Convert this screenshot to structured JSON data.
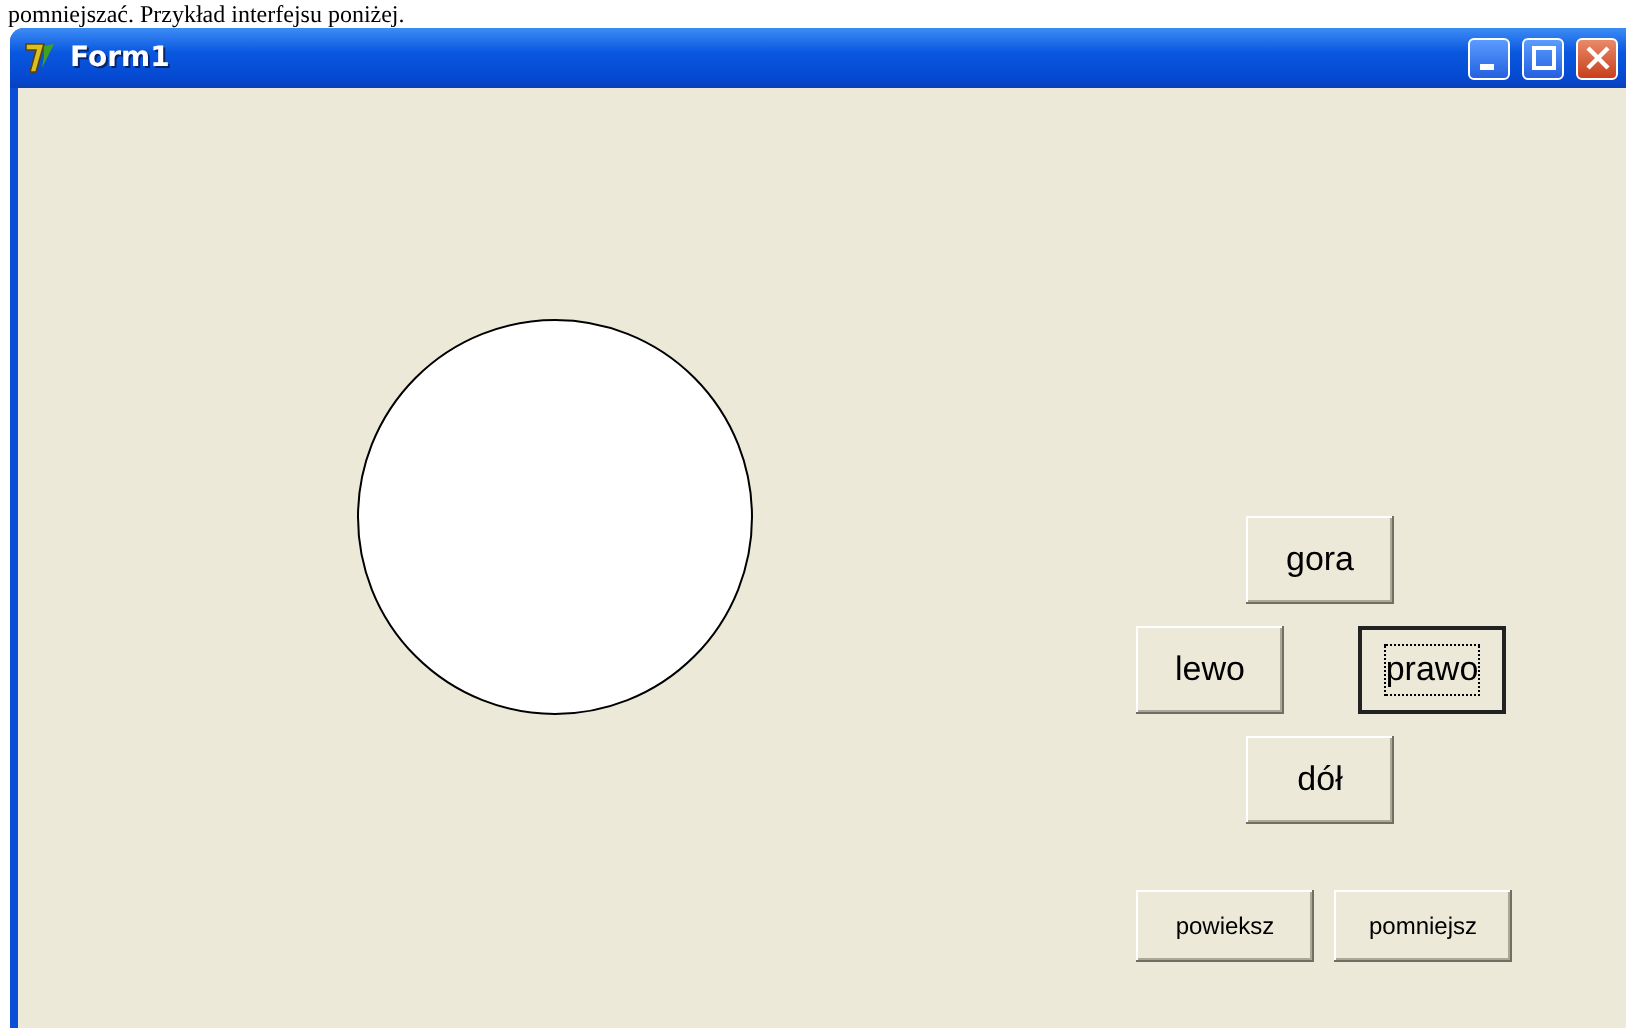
{
  "document_text": "pomniejszać. Przykład interfejsu poniżej.",
  "window": {
    "title": "Form1"
  },
  "form": {
    "shape": {
      "kind": "circle"
    },
    "buttons": [
      {
        "label": "gora",
        "kind": "large",
        "focused": false
      },
      {
        "label": "lewo",
        "kind": "large",
        "focused": false
      },
      {
        "label": "prawo",
        "kind": "large",
        "focused": true
      },
      {
        "label": "dół",
        "kind": "large",
        "focused": false
      },
      {
        "label": "powieksz",
        "kind": "small",
        "focused": false
      },
      {
        "label": "pomniejsz",
        "kind": "small",
        "focused": false
      }
    ]
  }
}
